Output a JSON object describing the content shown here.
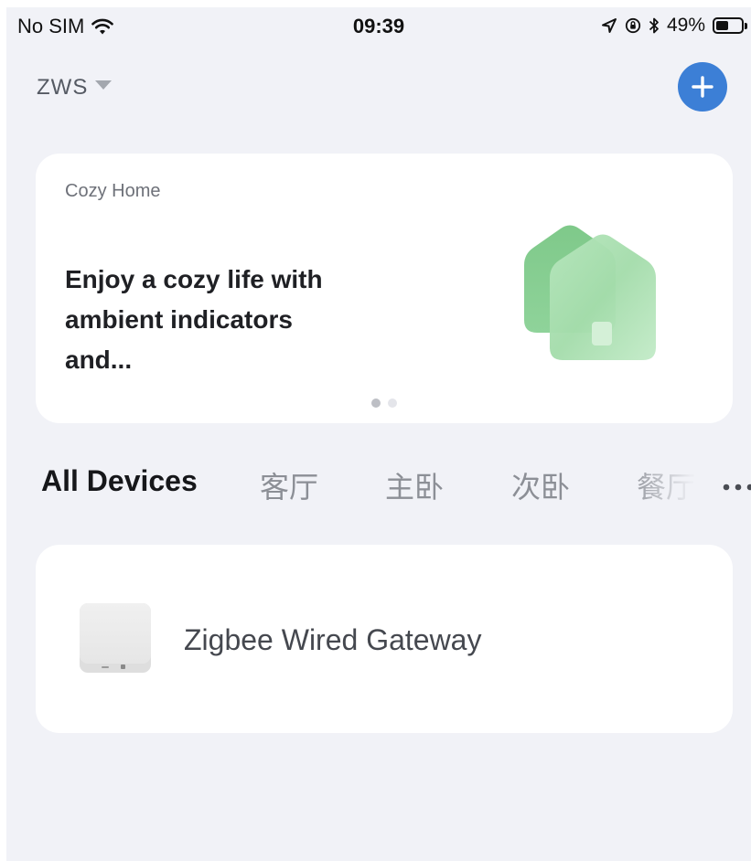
{
  "status_bar": {
    "carrier": "No SIM",
    "time": "09:39",
    "battery_text": "49%",
    "battery_level": 0.49,
    "icons": [
      "wifi-icon",
      "location-arrow-icon",
      "orientation-lock-icon",
      "bluetooth-icon",
      "battery-icon"
    ]
  },
  "header": {
    "home_name": "ZWS",
    "add_icon": "plus-icon",
    "accent_color": "#3c7fd6"
  },
  "banner": {
    "eyebrow": "Cozy Home",
    "title": "Enjoy a cozy life with ambient indicators and...",
    "page_count": 2,
    "active_page": 1,
    "art_icon": "house-illustration-icon"
  },
  "tabs": {
    "items": [
      {
        "label": "All Devices",
        "active": true
      },
      {
        "label": "客厅",
        "active": false
      },
      {
        "label": "主卧",
        "active": false
      },
      {
        "label": "次卧",
        "active": false
      },
      {
        "label": "餐厅",
        "active": false
      }
    ],
    "more_icon": "more-dots-icon"
  },
  "devices": [
    {
      "name": "Zigbee Wired Gateway",
      "icon": "gateway-device-icon"
    }
  ]
}
